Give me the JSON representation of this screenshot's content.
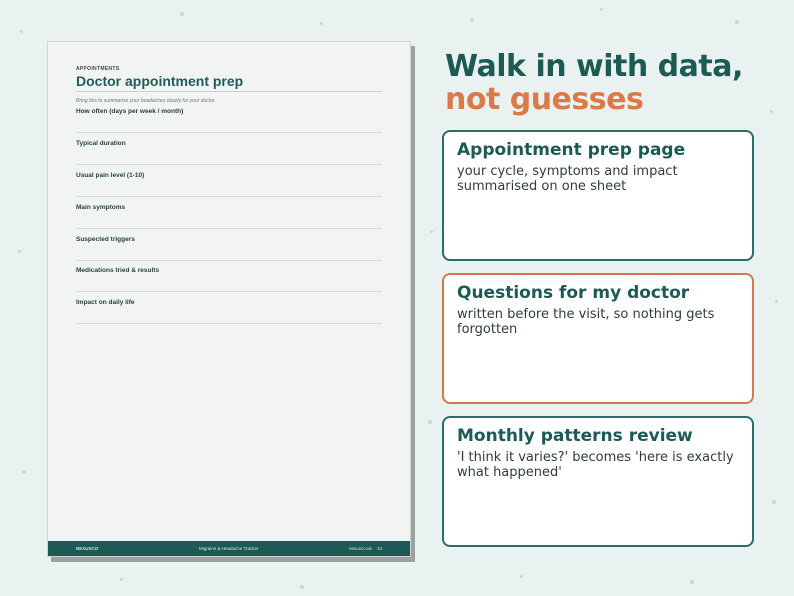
{
  "document": {
    "eyebrow": "APPOINTMENTS",
    "title": "Doctor appointment prep",
    "intro": "Bring this to summarise your headaches clearly for your doctor.",
    "fields": [
      {
        "label": "How often (days per week / month)"
      },
      {
        "label": "Typical duration"
      },
      {
        "label": "Usual pain level (1-10)"
      },
      {
        "label": "Main symptoms"
      },
      {
        "label": "Suspected triggers"
      },
      {
        "label": "Medications tried & results"
      },
      {
        "label": "Impact on daily life"
      }
    ],
    "footer": {
      "brand": "NEXUXCO",
      "product": "Migraine & Headache Tracker",
      "url": "nexuxco.uk",
      "page": "13"
    }
  },
  "headline": {
    "line1": "Walk in with data,",
    "line2": "not guesses"
  },
  "cards": [
    {
      "title": "Appointment prep page",
      "body": "your cycle, symptoms and impact summarised on one sheet"
    },
    {
      "title": "Questions for my doctor",
      "body": "written before the visit, so nothing gets forgotten"
    },
    {
      "title": "Monthly patterns review",
      "body": "'I think it varies?' becomes 'here is exactly what happened'"
    }
  ],
  "colors": {
    "teal": "#1d5a54",
    "orange": "#d97a48",
    "background": "#eaf2f1"
  }
}
